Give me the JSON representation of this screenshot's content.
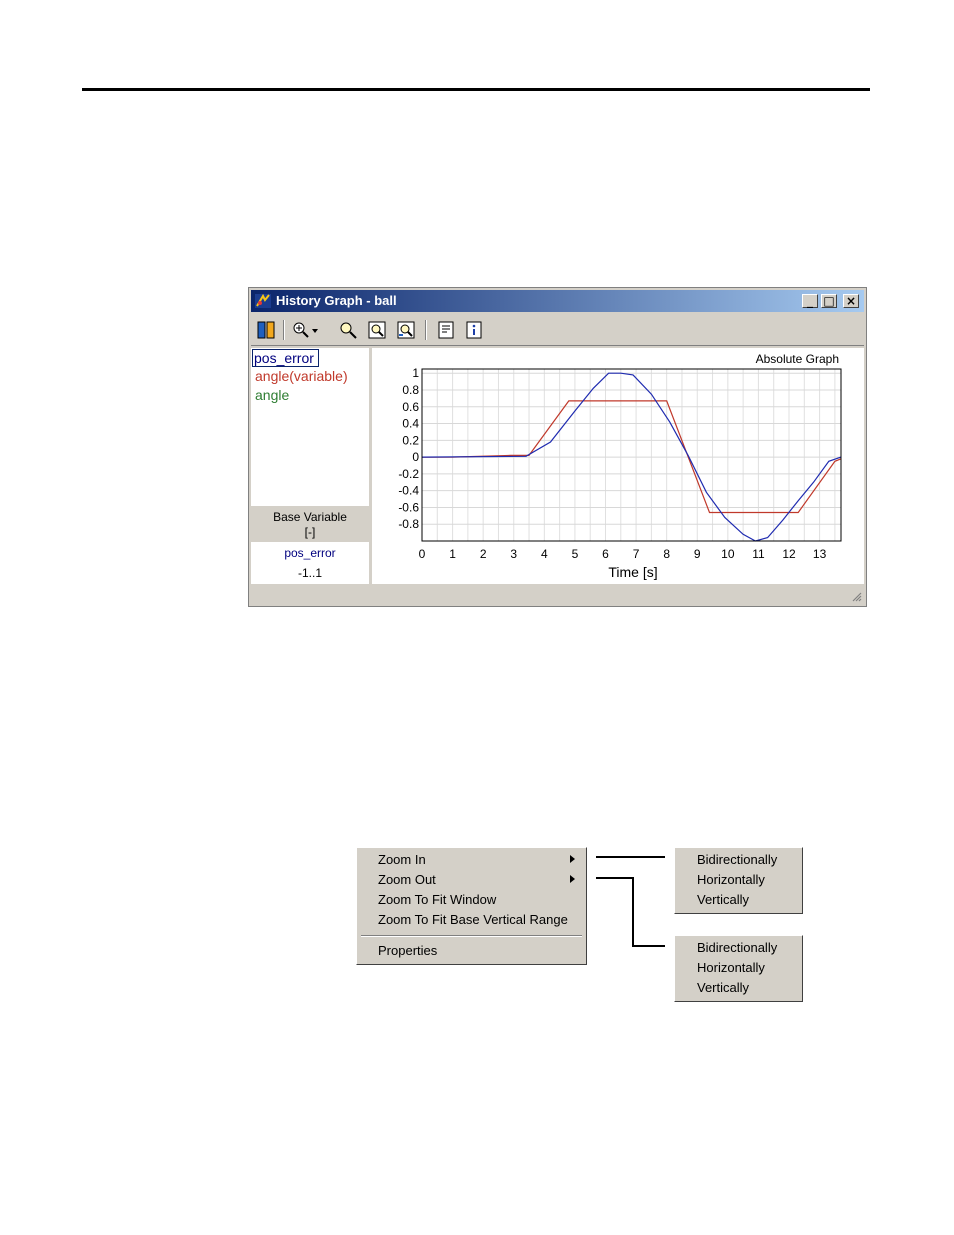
{
  "window": {
    "title": "History Graph - ball",
    "buttons": [
      "_",
      "□",
      "×"
    ]
  },
  "toolbar": {
    "icons": [
      "columns-icon",
      "zoom-dropdown-icon",
      "zoom-icon",
      "zoom-fit-icon",
      "zoom-range-icon",
      "properties-icon",
      "info-icon"
    ]
  },
  "legend": {
    "items": [
      {
        "label": "pos_error",
        "color": "#00007f"
      },
      {
        "label": "angle(variable)",
        "color": "#c0392b"
      },
      {
        "label": "angle",
        "color": "#2e7d32"
      }
    ],
    "base_variable_label": "Base Variable",
    "base_variable_unit": "[-]",
    "base_variable_name": "pos_error",
    "base_variable_range": "-1..1"
  },
  "graph": {
    "mode_label": "Absolute Graph",
    "xlabel": "Time [s]"
  },
  "chart_data": {
    "type": "line",
    "xlabel": "Time [s]",
    "ylabel": "",
    "xlim": [
      0,
      13.7
    ],
    "ylim": [
      -1,
      1.05
    ],
    "xticks": [
      "0",
      "1",
      "2",
      "3",
      "4",
      "5",
      "6",
      "7",
      "8",
      "9",
      "10",
      "11",
      "12",
      "13"
    ],
    "yticks": [
      "1",
      "0.8",
      "0.6",
      "0.4",
      "0.2",
      "0",
      "-0.2",
      "-0.4",
      "-0.6",
      "-0.8"
    ],
    "grid": true,
    "series": [
      {
        "name": "angle(variable)",
        "color": "#c0392b",
        "x": [
          0,
          1.0,
          2.9,
          3.5,
          4.8,
          8.0,
          9.4,
          11.8,
          12.3,
          13.5,
          13.7
        ],
        "y": [
          0,
          0,
          0.02,
          0.02,
          0.67,
          0.67,
          -0.66,
          -0.66,
          -0.66,
          -0.05,
          -0.02
        ]
      },
      {
        "name": "pos_error",
        "color": "#1f2bb0",
        "x": [
          0,
          3.4,
          4.2,
          5.0,
          5.6,
          6.1,
          6.5,
          6.9,
          7.5,
          8.1,
          8.7,
          9.3,
          9.9,
          10.5,
          10.9,
          11.3,
          11.8,
          12.3,
          12.8,
          13.3,
          13.7
        ],
        "y": [
          0,
          0.01,
          0.18,
          0.55,
          0.82,
          1.0,
          1.0,
          0.98,
          0.75,
          0.42,
          0.02,
          -0.42,
          -0.72,
          -0.92,
          -1.0,
          -0.96,
          -0.75,
          -0.52,
          -0.3,
          -0.05,
          0.0
        ]
      }
    ]
  },
  "context_menu": {
    "items": [
      {
        "label": "Zoom In",
        "submenu": true
      },
      {
        "label": "Zoom Out",
        "submenu": true
      },
      {
        "label": "Zoom To Fit Window",
        "submenu": false
      },
      {
        "label": "Zoom To Fit Base Vertical Range",
        "submenu": false
      },
      {
        "label": "Properties",
        "submenu": false
      }
    ],
    "zoom_in_submenu": [
      "Bidirectionally",
      "Horizontally",
      "Vertically"
    ],
    "zoom_out_submenu": [
      "Bidirectionally",
      "Horizontally",
      "Vertically"
    ]
  }
}
